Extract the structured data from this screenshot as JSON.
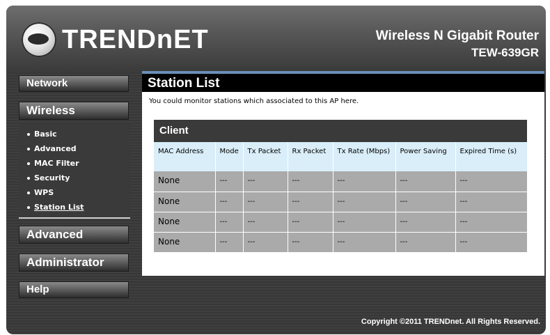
{
  "header": {
    "logo_text": "TRENDnET",
    "product_name": "Wireless N Gigabit Router",
    "model": "TEW-639GR"
  },
  "sidebar": {
    "network": "Network",
    "wireless": "Wireless",
    "submenu": [
      "Basic",
      "Advanced",
      "MAC Filter",
      "Security",
      "WPS",
      "Station List"
    ],
    "advanced": "Advanced",
    "administrator": "Administrator",
    "help": "Help"
  },
  "page": {
    "title": "Station List",
    "description": "You could monitor stations which associated to this AP here."
  },
  "client_table": {
    "heading": "Client",
    "columns": [
      "MAC Address",
      "Mode",
      "Tx Packet",
      "Rx Packet",
      "Tx Rate (Mbps)",
      "Power Saving",
      "Expired Time (s)"
    ],
    "rows": [
      [
        "None",
        "---",
        "---",
        "---",
        "---",
        "---",
        "---"
      ],
      [
        "None",
        "---",
        "---",
        "---",
        "---",
        "---",
        "---"
      ],
      [
        "None",
        "---",
        "---",
        "---",
        "---",
        "---",
        "---"
      ],
      [
        "None",
        "---",
        "---",
        "---",
        "---",
        "---",
        "---"
      ]
    ]
  },
  "footer": {
    "copyright": "Copyright ©2011 TRENDnet. All Rights Reserved."
  },
  "colors": {
    "title_accent": "#6b8fb8",
    "header_row_bg": "#d9eef9",
    "cell_bg": "#aaaaaa"
  }
}
